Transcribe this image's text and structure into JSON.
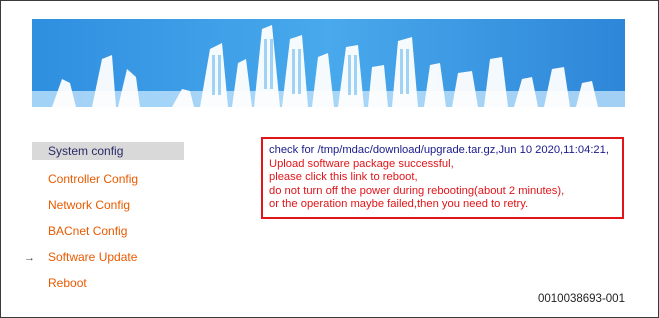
{
  "sidebar": {
    "items": [
      {
        "label": "System config",
        "active": false
      },
      {
        "label": "Controller Config"
      },
      {
        "label": "Network Config"
      },
      {
        "label": "BACnet Config"
      },
      {
        "label": "Software Update",
        "current": true
      },
      {
        "label": "Reboot"
      }
    ]
  },
  "message": {
    "lines": [
      "check for /tmp/mdac/download/upgrade.tar.gz,Jun 10 2020,11:04:21,",
      "Upload software package successful,",
      "please click this link to reboot,",
      "do not turn off the power during rebooting(about 2 minutes),",
      "or the operation maybe failed,then you need to retry."
    ]
  },
  "figure_ref": "0010038693-001",
  "colors": {
    "accent": "#e85a00",
    "highlight_border": "#e0151a",
    "banner": "#3aa0e6"
  }
}
